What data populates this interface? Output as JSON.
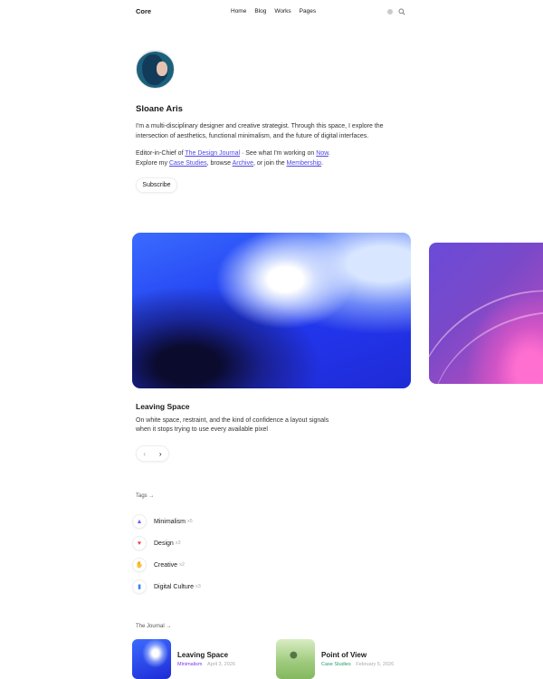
{
  "nav": {
    "brand": "Core",
    "links": [
      "Home",
      "Blog",
      "Works",
      "Pages"
    ]
  },
  "profile": {
    "name": "Sloane Aris",
    "bio": "I'm a multi-disciplinary designer and creative strategist. Through this space, I explore the intersection of aesthetics, functional minimalism, and the future of digital interfaces.",
    "line_a_prefix": "Editor-in-Chief of ",
    "line_a_link1": "The Design Journal",
    "line_a_mid": " · See what I'm working on ",
    "line_a_link2": "Now",
    "line_a_suffix": ".",
    "line_b_prefix": "Explore my ",
    "line_b_link1": "Case Studies",
    "line_b_mid1": ", browse ",
    "line_b_link2": "Archive",
    "line_b_mid2": ", or join the ",
    "line_b_link3": "Membership",
    "line_b_suffix": ".",
    "subscribe_label": "Subscribe"
  },
  "featured": {
    "title": "Leaving Space",
    "description": "On white space, restraint, and the kind of confidence a layout signals when it stops trying to use every available pixel",
    "prev_icon": "‹",
    "next_icon": "›"
  },
  "tags_section": {
    "label": "Tags →",
    "items": [
      {
        "name": "Minimalism",
        "count": "x5",
        "icon": "▲",
        "color": "#6d5dfc"
      },
      {
        "name": "Design",
        "count": "x3",
        "icon": "♥",
        "color": "#ef4444"
      },
      {
        "name": "Creative",
        "count": "x2",
        "icon": "✋",
        "color": "#f59e0b"
      },
      {
        "name": "Digital Culture",
        "count": "x3",
        "icon": "▮",
        "color": "#3b82f6"
      }
    ]
  },
  "journal_section": {
    "label": "The Journal →",
    "items": [
      {
        "title": "Leaving Space",
        "category": "Minimalism",
        "date": "April 3, 2026"
      },
      {
        "title": "Point of View",
        "category": "Case Studies",
        "date": "February 5, 2026"
      }
    ]
  }
}
